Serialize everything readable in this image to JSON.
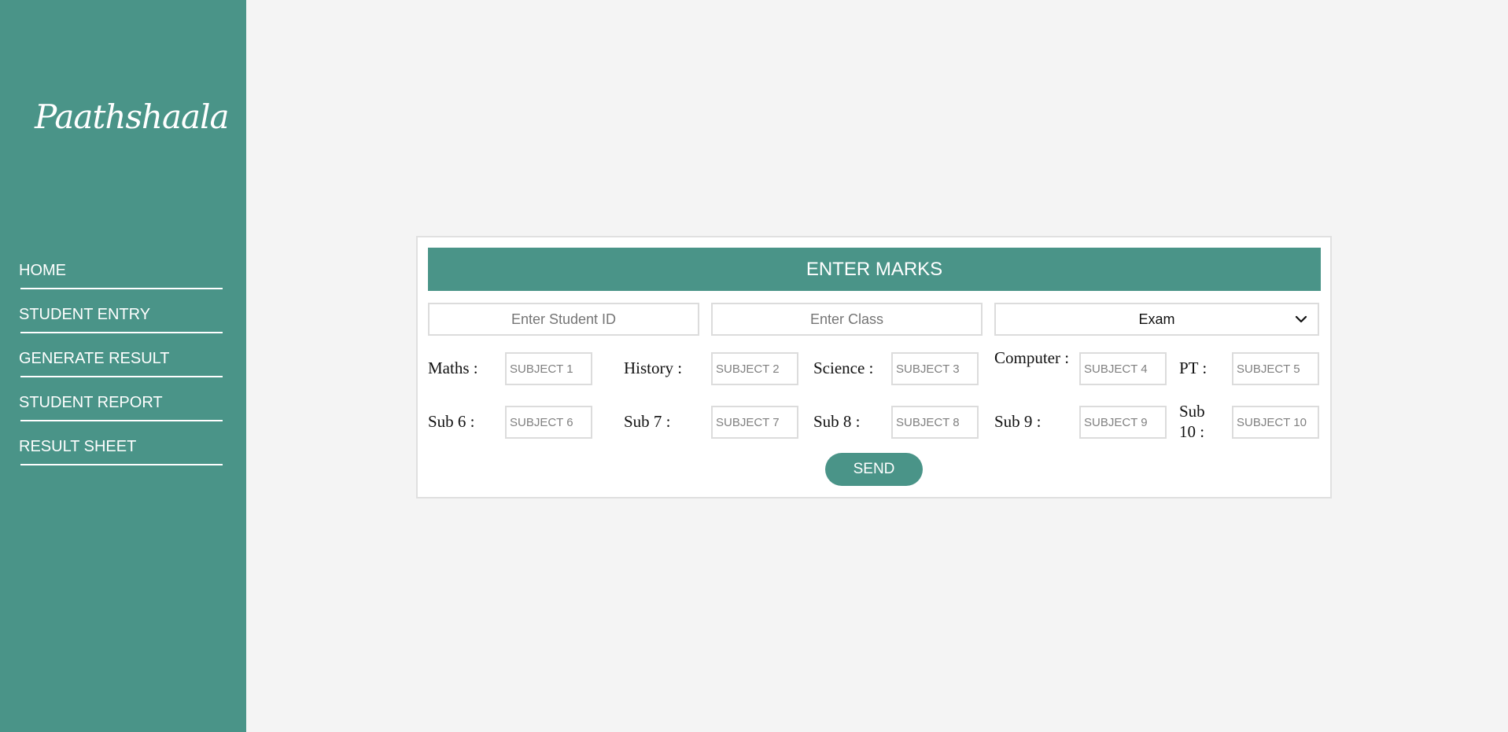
{
  "app": {
    "brand": "Paathshaala"
  },
  "sidebar": {
    "items": [
      {
        "label": "HOME"
      },
      {
        "label": "STUDENT ENTRY"
      },
      {
        "label": "GENERATE RESULT"
      },
      {
        "label": "STUDENT REPORT"
      },
      {
        "label": "RESULT SHEET"
      }
    ]
  },
  "form": {
    "title": "ENTER MARKS",
    "student_id_placeholder": "Enter Student ID",
    "class_placeholder": "Enter Class",
    "exam_selected": "Exam",
    "subjects": [
      {
        "label": "Maths :",
        "placeholder": "SUBJECT 1"
      },
      {
        "label": "History :",
        "placeholder": "SUBJECT 2"
      },
      {
        "label": "Science :",
        "placeholder": "SUBJECT 3"
      },
      {
        "label": "Computer :",
        "placeholder": "SUBJECT 4"
      },
      {
        "label": "PT :",
        "placeholder": "SUBJECT 5"
      },
      {
        "label": "Sub 6 :",
        "placeholder": "SUBJECT 6"
      },
      {
        "label": "Sub 7 :",
        "placeholder": "SUBJECT 7"
      },
      {
        "label": "Sub 8 :",
        "placeholder": "SUBJECT 8"
      },
      {
        "label": "Sub 9 :",
        "placeholder": "SUBJECT 9"
      },
      {
        "label": "Sub 10 :",
        "placeholder": "SUBJECT 10"
      }
    ],
    "send_label": "SEND"
  },
  "colors": {
    "accent": "#4a9488",
    "page_background": "#f4f4f4",
    "card_background": "#ffffff"
  },
  "icons": {
    "exam_dropdown": "chevron-down-icon"
  }
}
